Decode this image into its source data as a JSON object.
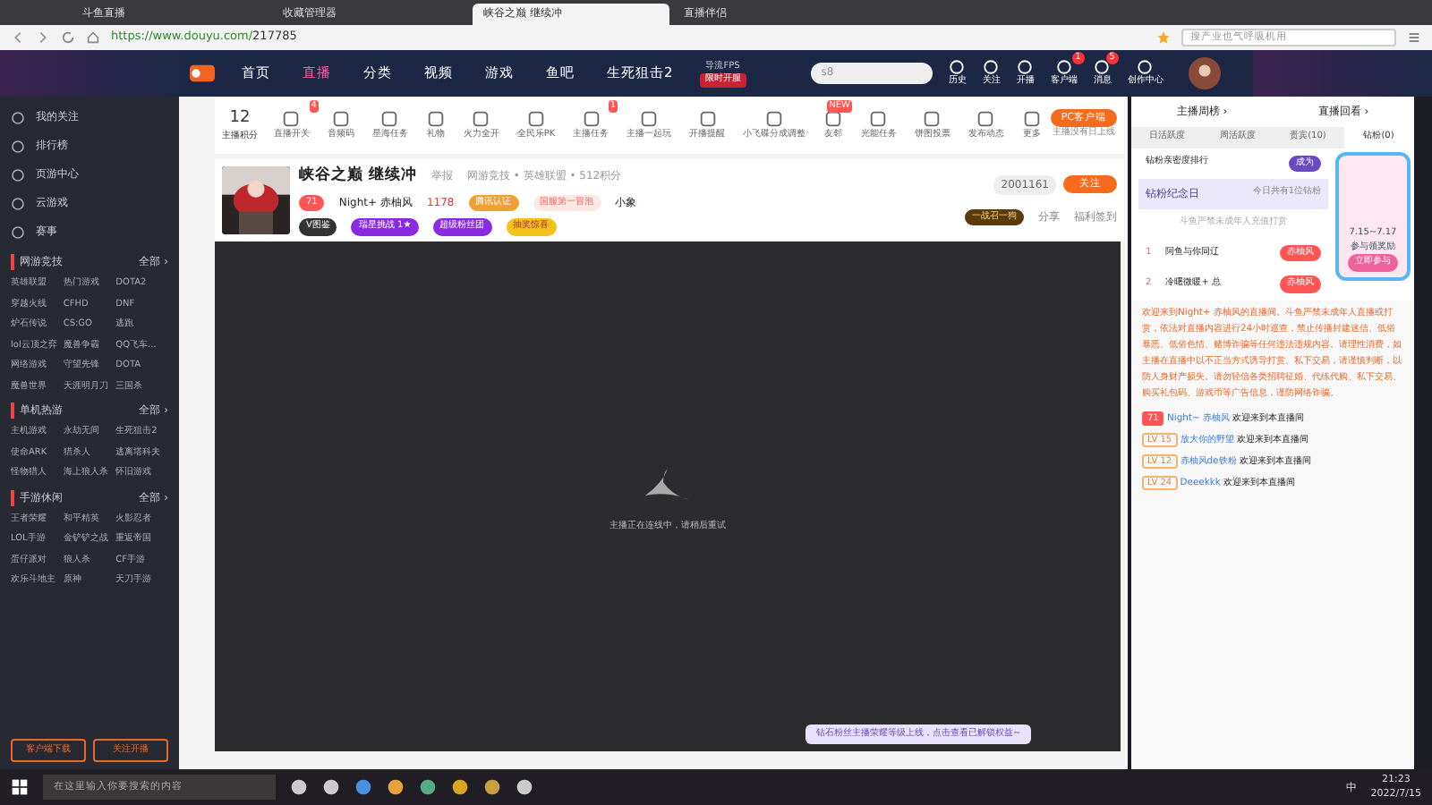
{
  "browser": {
    "tabs": [
      {
        "title": "斗鱼直播",
        "selected": false
      },
      {
        "title": "收藏管理器",
        "selected": false
      },
      {
        "title": "峡谷之巅 继续冲",
        "selected": true
      },
      {
        "title": "直播伴侣",
        "selected": false
      }
    ],
    "url_host": "https://www.douyu.com/",
    "url_path": "217785",
    "search_placeholder": "搜产业也气呼吸机用"
  },
  "site_nav": {
    "items": [
      {
        "label": "首页",
        "selected": false
      },
      {
        "label": "直播",
        "selected": true
      },
      {
        "label": "分类",
        "selected": false
      },
      {
        "label": "视频",
        "selected": false
      },
      {
        "label": "游戏",
        "selected": false
      },
      {
        "label": "鱼吧",
        "selected": false
      },
      {
        "label": "生死狙击2",
        "selected": false
      }
    ],
    "promo_top": "导流FPS",
    "promo_button": "限时开服",
    "search_value": "s8",
    "actions": [
      {
        "label": "历史"
      },
      {
        "label": "关注"
      },
      {
        "label": "开播"
      },
      {
        "label": "客户端",
        "badge": "1"
      },
      {
        "label": "消息",
        "badge": "5"
      },
      {
        "label": "创作中心"
      }
    ]
  },
  "sidebar": {
    "items": [
      {
        "label": "我的关注"
      },
      {
        "label": "排行榜"
      },
      {
        "label": "页游中心"
      },
      {
        "label": "云游戏"
      },
      {
        "label": "赛事"
      }
    ],
    "sections": [
      {
        "title": "网游竞技",
        "more": "全部 ›",
        "games": [
          "英雄联盟",
          "热门游戏",
          "DOTA2",
          "穿越火线",
          "CFHD",
          "DNF",
          "炉石传说",
          "CS:GO",
          "逃跑",
          "lol云顶之弈",
          "魔兽争霸",
          "QQ飞车...",
          "网络游戏",
          "守望先锋",
          "DOTA",
          "魔兽世界",
          "天涯明月刀",
          "三国杀"
        ]
      },
      {
        "title": "单机热游",
        "more": "全部 ›",
        "games": [
          "主机游戏",
          "永劫无间",
          "生死狙击2",
          "使命ARK",
          "猎杀人",
          "逃离塔科夫",
          "怪物猎人",
          "海上狼人杀",
          "怀旧游戏"
        ]
      },
      {
        "title": "手游休闲",
        "more": "全部 ›",
        "games": [
          "王者荣耀",
          "和平精英",
          "火影忍者",
          "LOL手游",
          "金铲铲之战",
          "重返帝国",
          "蛋仔派对",
          "狼人杀",
          "CF手游",
          "欢乐斗地主",
          "原神",
          "天刀手游"
        ]
      }
    ],
    "buttons": [
      "客户端下载",
      "关注开播"
    ]
  },
  "toolbar": {
    "score": "12",
    "score_label": "主播积分",
    "tools": [
      {
        "label": "直播开关",
        "badge": "4"
      },
      {
        "label": "音频码"
      },
      {
        "label": "星海任务"
      },
      {
        "label": "礼物"
      },
      {
        "label": "火力全开"
      },
      {
        "label": "全民乐PK"
      },
      {
        "label": "主播任务",
        "badge": "1"
      },
      {
        "label": "主播一起玩"
      },
      {
        "label": "开播提醒"
      },
      {
        "label": "小飞碟分成调整"
      },
      {
        "label": "友邻",
        "badge": "NEW"
      },
      {
        "label": "光能任务"
      },
      {
        "label": "饼图投票"
      },
      {
        "label": "发布动态"
      },
      {
        "label": "更多"
      }
    ],
    "client_button": "PC客户端",
    "client_note": "主播没有日上线"
  },
  "streamer": {
    "title": "峡谷之巅 继续冲",
    "report": "举报",
    "category": "网游竞技 • 英雄联盟 • 512积分",
    "level": "71",
    "name": "Night+ 赤柚风",
    "heat": "1178",
    "tag1": "腾讯认证",
    "tag2": "国服第一冒泡",
    "follow_count": "小象",
    "chips": [
      "V图鉴",
      "瑞星挑战 1★",
      "超级粉丝团",
      "抽奖惊喜"
    ],
    "room_id": "2001161",
    "follow": "关注",
    "banner": "一战召一狗",
    "share": "分享",
    "gift_sign": "福利签到"
  },
  "video": {
    "status": "主播正在连线中，请稍后重试",
    "toast": "钻石粉丝主播荣耀等级上线，点击查看已解锁权益~"
  },
  "panel": {
    "top_tabs": [
      "主播周榜 ›",
      "直播回看 ›"
    ],
    "tabs": [
      {
        "label": "日活跃度",
        "selected": false
      },
      {
        "label": "周活跃度",
        "selected": false
      },
      {
        "label": "贵宾(10)",
        "selected": false
      },
      {
        "label": "钻粉(0)",
        "selected": true
      }
    ],
    "rank_title": "钻粉亲密度排行",
    "rank_badge": "成为",
    "anniv_title": "钻粉纪念日",
    "anniv_note": "今日共有1位钻粉",
    "anniv_empty": "斗鱼严禁未成年人充值打赏",
    "ranks": [
      {
        "rank": "1",
        "name": "阿鱼与你同辽",
        "tag": "赤柚风"
      },
      {
        "rank": "2",
        "name": "冷曙微暖+ 总",
        "tag": "赤柚风"
      }
    ],
    "promo_date": "7.15~7.17",
    "promo_text": "参与领奖励",
    "promo_button": "立即参与",
    "notice": "欢迎来到Night+ 赤柚风的直播间。斗鱼严禁未成年人直播或打赏，依法对直播内容进行24小时巡查，禁止传播封建迷信、低俗暴恶、低俗色情、赌博诈骗等任何违法违规内容。请理性消费，如主播在直播中以不正当方式诱导打赏、私下交易，请谨慎判断，以防人身财产损失。请勿轻信各类招聘征婚、代练代购、私下交易、购买礼包码、游戏币等广告信息，谨防网络诈骗。",
    "messages": [
      {
        "level": "71",
        "user": "Night~ 赤柚风",
        "text": "欢迎来到本直播间"
      },
      {
        "level": "LV 15",
        "user": "放大你的野望",
        "text": "欢迎来到本直播间"
      },
      {
        "level": "LV 12",
        "user": "赤柚风de铁粉",
        "text": "欢迎来到本直播间"
      },
      {
        "level": "LV 24",
        "user": "Deeekkk",
        "text": "欢迎来到本直播间"
      }
    ]
  },
  "taskbar": {
    "search": "在这里输入你要搜索的内容",
    "time": "21:23",
    "date": "2022/7/15",
    "tray_text": "中"
  }
}
